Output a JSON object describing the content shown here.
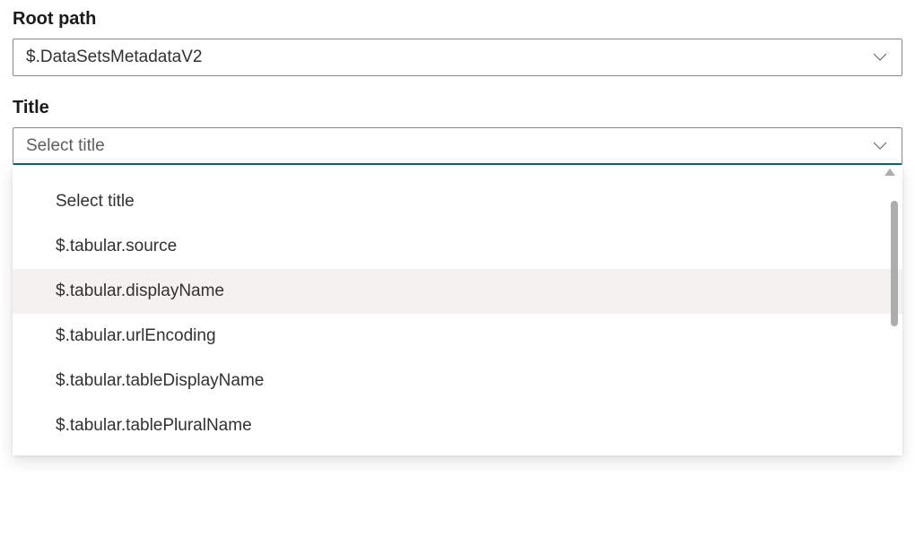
{
  "rootPath": {
    "label": "Root path",
    "value": "$.DataSetsMetadataV2"
  },
  "title": {
    "label": "Title",
    "placeholder": "Select title",
    "options": {
      "0": "Select title",
      "1": "$.tabular.source",
      "2": "$.tabular.displayName",
      "3": "$.tabular.urlEncoding",
      "4": "$.tabular.tableDisplayName",
      "5": "$.tabular.tablePluralName"
    }
  }
}
